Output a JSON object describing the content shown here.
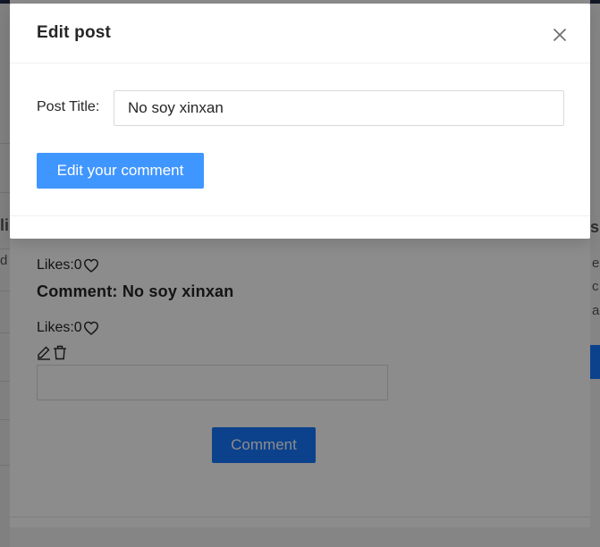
{
  "modal": {
    "title": "Edit post",
    "form": {
      "label": "Post Title",
      "label_colon": ":",
      "value": "No soy xinxan"
    },
    "edit_button": "Edit your comment",
    "close_icon": "close-icon"
  },
  "background": {
    "likes_label": "Likes: ",
    "likes_count_1": "0",
    "likes_count_2": "0",
    "comment_prefix": "Comment: ",
    "comment_text": "No soy xinxan",
    "comment_button": "Comment",
    "right_fragments": [
      "s",
      "e",
      "c",
      "a"
    ],
    "left_fragments": [
      "li",
      "d"
    ],
    "icons": [
      "heart-icon",
      "edit-icon",
      "delete-icon"
    ]
  },
  "colors": {
    "primary": "#4096ff",
    "primary_bg": "#1677ff",
    "overlay": "rgba(0,0,0,0.45)"
  }
}
